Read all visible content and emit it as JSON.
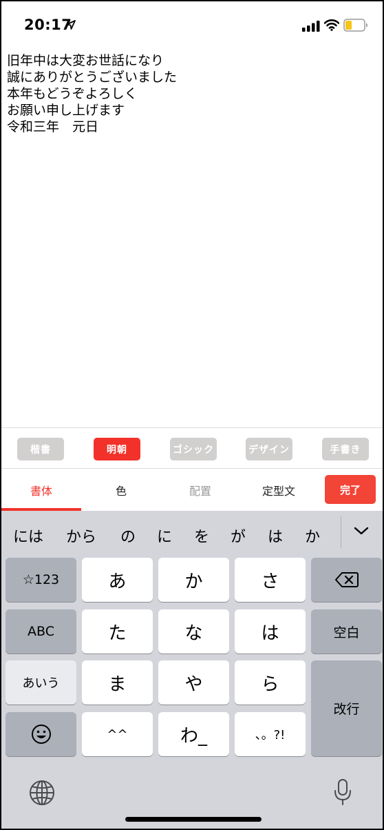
{
  "status_bar": {
    "time": "20:17"
  },
  "message": {
    "lines": [
      "旧年中は大変お世話になり",
      "誠にありがとうございました",
      "本年もどうぞよろしく",
      "お願い申し上げます",
      "令和三年　元日"
    ]
  },
  "font_styles": {
    "items": [
      "楷書",
      "明朝",
      "ゴシック",
      "デザイン",
      "手書き"
    ],
    "selected": "明朝"
  },
  "tabs": {
    "items": [
      "書体",
      "色",
      "配置",
      "定型文"
    ],
    "active": "書体",
    "done_label": "完了"
  },
  "keyboard": {
    "candidates": [
      "には",
      "から",
      "の",
      "に",
      "を",
      "が",
      "は",
      "か"
    ],
    "keys": {
      "symbols": "☆123",
      "a": "あ",
      "ka": "か",
      "sa": "さ",
      "abc": "ABC",
      "ta": "た",
      "na": "な",
      "ha": "は",
      "space": "空白",
      "kana": "あいう",
      "ma": "ま",
      "ya": "や",
      "ra": "ら",
      "return": "改行",
      "dakuten": "^^",
      "wa": "わ_",
      "punct": "、。?!"
    }
  },
  "colors": {
    "accent": "#f2322a",
    "inactive_chip": "#d2cfcf",
    "keyboard_bg": "#d3d5db"
  }
}
